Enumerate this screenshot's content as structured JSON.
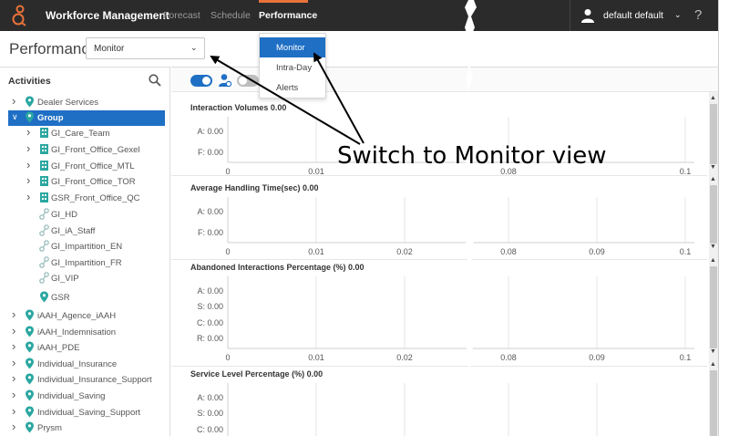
{
  "header": {
    "app_title": "Workforce Management",
    "nav": [
      "Forecast",
      "Schedule",
      "Performance"
    ],
    "active_nav": "Performance",
    "user_name": "default default",
    "help": "?",
    "accent": "#e8723a",
    "bg": "#2b2b2b"
  },
  "page": {
    "title": "Performance",
    "view_select_value": "Monitor"
  },
  "view_menu": {
    "items": [
      "Monitor",
      "Intra-Day",
      "Alerts"
    ],
    "selected": "Monitor",
    "highlight": "#1f6fc5"
  },
  "activities": {
    "title": "Activities",
    "items": [
      {
        "label": "Dealer Services",
        "icon": "location-pin-icon",
        "expand": "right"
      },
      {
        "label": "Group",
        "icon": "location-pin-icon",
        "expand": "down",
        "selected": true
      },
      {
        "label": "GI_Care_Team",
        "icon": "building-icon",
        "expand": "right"
      },
      {
        "label": "GI_Front_Office_Gexel",
        "icon": "building-icon",
        "expand": "right"
      },
      {
        "label": "GI_Front_Office_MTL",
        "icon": "building-icon",
        "expand": "right"
      },
      {
        "label": "GI_Front_Office_TOR",
        "icon": "building-icon",
        "expand": "right"
      },
      {
        "label": "GSR_Front_Office_QC",
        "icon": "building-icon",
        "expand": "right"
      },
      {
        "label": "GI_HD",
        "icon": "activity-link-icon"
      },
      {
        "label": "GI_iA_Staff",
        "icon": "activity-link-icon"
      },
      {
        "label": "GI_Impartition_EN",
        "icon": "activity-link-icon"
      },
      {
        "label": "GI_Impartition_FR",
        "icon": "activity-link-icon"
      },
      {
        "label": "GI_VIP",
        "icon": "activity-link-icon"
      },
      {
        "label": "GSR",
        "icon": "location-pin-icon"
      },
      {
        "label": "iAAH_Agence_iAAH",
        "icon": "location-pin-icon",
        "expand": "right"
      },
      {
        "label": "iAAH_Indemnisation",
        "icon": "location-pin-icon",
        "expand": "right"
      },
      {
        "label": "iAAH_PDE",
        "icon": "location-pin-icon",
        "expand": "right"
      },
      {
        "label": "Individual_Insurance",
        "icon": "location-pin-icon",
        "expand": "right"
      },
      {
        "label": "Individual_Insurance_Support",
        "icon": "location-pin-icon",
        "expand": "right"
      },
      {
        "label": "Individual_Saving",
        "icon": "location-pin-icon",
        "expand": "right"
      },
      {
        "label": "Individual_Saving_Support",
        "icon": "location-pin-icon",
        "expand": "right"
      },
      {
        "label": "Prysm",
        "icon": "location-pin-icon",
        "expand": "right"
      }
    ]
  },
  "chart_data": [
    {
      "type": "bar",
      "title": "Interaction Volumes 0.00",
      "categories": [
        "A: 0.00",
        "F: 0.00"
      ],
      "values": [
        0,
        0
      ],
      "x_ticks": [
        "0",
        "0.01",
        "0.08",
        "0.1"
      ]
    },
    {
      "type": "bar",
      "title": "Average Handling Time(sec) 0.00",
      "categories": [
        "A: 0.00",
        "F: 0.00"
      ],
      "values": [
        0,
        0
      ],
      "x_ticks": [
        "0",
        "0.01",
        "0.02",
        "0.08",
        "0.09",
        "0.1"
      ]
    },
    {
      "type": "bar",
      "title": "Abandoned Interactions Percentage (%) 0.00",
      "categories": [
        "A: 0.00",
        "S: 0.00",
        "C: 0.00",
        "R: 0.00"
      ],
      "values": [
        0,
        0,
        0,
        0
      ],
      "x_ticks": [
        "0",
        "0.01",
        "0.02",
        "0.08",
        "0.09",
        "0.1"
      ]
    },
    {
      "type": "bar",
      "title": "Service Level Percentage (%) 0.00",
      "categories": [
        "A: 0.00",
        "S: 0.00",
        "C: 0.00"
      ],
      "values": [
        0,
        0,
        0
      ],
      "x_ticks": []
    }
  ],
  "annotation": {
    "text": "Switch to Monitor view"
  }
}
